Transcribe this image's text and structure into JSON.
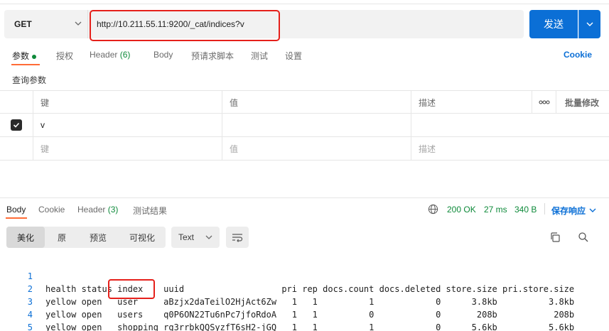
{
  "request": {
    "method": "GET",
    "url": "http://10.211.55.11:9200/_cat/indices?v",
    "send_label": "发送"
  },
  "req_tabs": [
    {
      "label": "参数"
    },
    {
      "label": "授权"
    },
    {
      "label": "Header",
      "count": "(6)"
    },
    {
      "label": "Body"
    },
    {
      "label": "预请求脚本"
    },
    {
      "label": "测试"
    },
    {
      "label": "设置"
    }
  ],
  "cookie_link": "Cookie",
  "query_params_label": "查询参数",
  "params_table": {
    "headers": {
      "key": "键",
      "value": "值",
      "desc": "描述",
      "more": "ooo",
      "bulk": "批量修改"
    },
    "rows": [
      {
        "key": "v",
        "value": "",
        "desc": ""
      }
    ],
    "placeholders": {
      "key": "键",
      "value": "值",
      "desc": "描述"
    }
  },
  "resp_tabs": [
    {
      "label": "Body"
    },
    {
      "label": "Cookie"
    },
    {
      "label": "Header",
      "count": "(3)"
    },
    {
      "label": "测试结果"
    }
  ],
  "status": {
    "code": "200 OK",
    "time": "27 ms",
    "size": "340 B",
    "save_label": "保存响应"
  },
  "view_modes": [
    "美化",
    "原",
    "预览",
    "可视化"
  ],
  "format": "Text",
  "response_lines": [
    {
      "n": "1",
      "text": "health status index    uuid                   pri rep docs.count docs.deleted store.size pri.store.size"
    },
    {
      "n": "2",
      "text": "yellow open   user     aBzjx2daTeilO2HjAct6Zw   1   1          1            0      3.8kb          3.8kb"
    },
    {
      "n": "3",
      "text": "yellow open   users    q0P6ON22Tu6nPc7jfoRdoA   1   1          0            0       208b           208b"
    },
    {
      "n": "4",
      "text": "yellow open   shopping rg3rrbkQQSyzfT6sH2-jGQ   1   1          1            0      5.6kb          5.6kb"
    },
    {
      "n": "5",
      "text": ""
    }
  ],
  "colors": {
    "accent": "#0b6fd6",
    "tab_active": "#ff6c37",
    "ok": "#0e8a3a",
    "highlight": "#e5201b"
  }
}
